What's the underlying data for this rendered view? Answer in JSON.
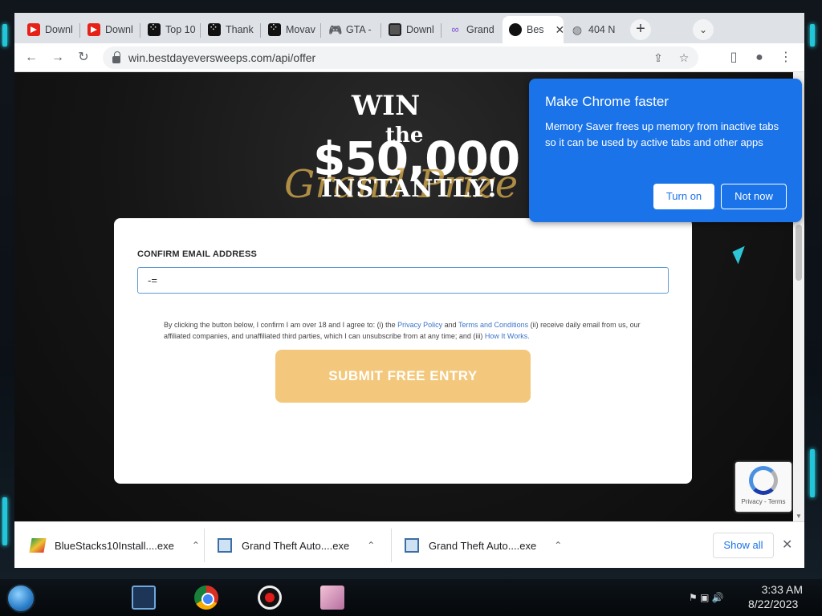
{
  "tabs": [
    {
      "label": "Downl",
      "icon": "youtube-icon"
    },
    {
      "label": "Downl",
      "icon": "youtube-icon"
    },
    {
      "label": "Top 10",
      "icon": "dice-icon"
    },
    {
      "label": "Thank",
      "icon": "dice-icon"
    },
    {
      "label": "Movav",
      "icon": "dice-icon"
    },
    {
      "label": "GTA -",
      "icon": "gamepad-icon"
    },
    {
      "label": "Downl",
      "icon": "picture-icon"
    },
    {
      "label": "Grand",
      "icon": "grand-icon"
    },
    {
      "label": "Bes",
      "icon": "site-icon",
      "active": true
    },
    {
      "label": "404 N",
      "icon": "globe-icon"
    }
  ],
  "omnibox": {
    "url": "win.bestdayeversweeps.com/api/offer"
  },
  "hero": {
    "line1": "WIN",
    "line2": "the",
    "amount": "$50,000",
    "script": "Grand Prize",
    "line3": "INSTANTLY!"
  },
  "form": {
    "label": "CONFIRM EMAIL ADDRESS",
    "email_value": "-=",
    "terms_prefix": "By clicking the button below, I confirm I am over 18 and I agree to: (i) the ",
    "privacy_link": "Privacy Policy",
    "and": " and ",
    "terms_link": "Terms and Conditions",
    "terms_middle": " (ii) receive daily email from us, our affiliated companies, and unaffiliated third parties, which I can unsubscribe from at any time; and (iii) ",
    "how_link": "How It Works.",
    "submit_label": "SUBMIT FREE ENTRY"
  },
  "recaptcha": {
    "links": "Privacy - Terms"
  },
  "popup": {
    "title": "Make Chrome faster",
    "body": "Memory Saver frees up memory from inactive tabs so it can be used by active tabs and other apps",
    "turn_on": "Turn on",
    "not_now": "Not now"
  },
  "downloads": {
    "items": [
      {
        "name": "BlueStacks10Install....exe"
      },
      {
        "name": "Grand Theft Auto....exe"
      },
      {
        "name": "Grand Theft Auto....exe"
      }
    ],
    "show_all": "Show all"
  },
  "taskbar": {
    "time": "3:33 AM",
    "date": "8/22/2023"
  },
  "colors": {
    "accent": "#1a73e8",
    "submit": "#f3c87c",
    "frame": "#22c6d9"
  }
}
